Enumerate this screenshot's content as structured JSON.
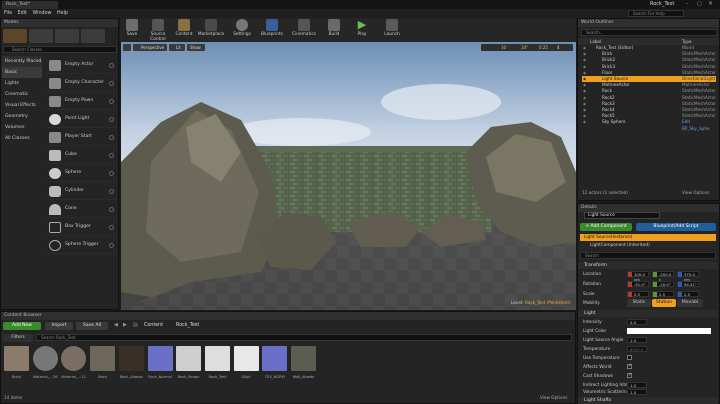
{
  "window": {
    "tab": "Rock_Test*",
    "project": "Rock_Test"
  },
  "menu": [
    "File",
    "Edit",
    "Window",
    "Help"
  ],
  "search_help": "Search For Help",
  "modes": {
    "title": "Modes",
    "search": "Search Classes",
    "categories": [
      "Recently Placed",
      "Basic",
      "Lights",
      "Cinematic",
      "Visual Effects",
      "Geometry",
      "Volumes",
      "All Classes"
    ],
    "items": [
      "Empty Actor",
      "Empty Character",
      "Empty Pawn",
      "Point Light",
      "Player Start",
      "Cube",
      "Sphere",
      "Cylinder",
      "Cone",
      "Box Trigger",
      "Sphere Trigger"
    ]
  },
  "toolbar": [
    "Save",
    "Source Control",
    "Content",
    "Marketplace",
    "Settings",
    "Blueprints",
    "Cinematics",
    "Build",
    "Play",
    "Launch"
  ],
  "viewport": {
    "perspective": "Perspective",
    "lit": "Lit",
    "show": "Show",
    "grid": "10",
    "angle": "10°",
    "scale": "0.25",
    "cam": "4",
    "level_label": "Level:",
    "level_name": "Rock_Test (Persistent)"
  },
  "outliner": {
    "title": "World Outliner",
    "search": "Search...",
    "col_label": "Label",
    "col_type": "Type",
    "rows": [
      [
        "Rock_Test (Editor)",
        "World"
      ],
      [
        "Brick",
        "StaticMeshActor"
      ],
      [
        "Brick2",
        "StaticMeshActor"
      ],
      [
        "Brick3",
        "StaticMeshActor"
      ],
      [
        "Floor",
        "StaticMeshActor"
      ],
      [
        "Light Source",
        "DirectionalLight"
      ],
      [
        "MatineeActor",
        "MatineeActor"
      ],
      [
        "Rock",
        "StaticMeshActor"
      ],
      [
        "Rock2",
        "StaticMeshActor"
      ],
      [
        "Rock3",
        "StaticMeshActor"
      ],
      [
        "Rock4",
        "StaticMeshActor"
      ],
      [
        "Rock5",
        "StaticMeshActor"
      ],
      [
        "Sky Sphere",
        "Edit BP_Sky_Sphe"
      ]
    ],
    "footer": "12 actors (1 selected)",
    "view_options": "View Options"
  },
  "details": {
    "title": "Details",
    "name": "Light Source",
    "add_component": "+ Add Component",
    "blueprint": "Blueprint/Add Script",
    "comp1": "Light Source(Instance)",
    "comp2": "LightComponent (Inherited)",
    "search": "Search",
    "transform": "Transform",
    "location": "Location",
    "rotation": "Rotation",
    "scale": "Scale",
    "loc": [
      "100.0 cm",
      "-200.0 c",
      "370.0 cm"
    ],
    "rot": [
      "-51.0°",
      "-20.0°",
      "94.41°"
    ],
    "scl": [
      "2.5",
      "2.5",
      "2.5"
    ],
    "mobility": "Mobility",
    "mob_opts": [
      "Static",
      "Station",
      "Movabl"
    ],
    "light": "Light",
    "intensity": "Intensity",
    "intensity_val": "5.0",
    "light_color": "Light Color",
    "source_angle": "Light Source Angle",
    "source_angle_val": "1.0",
    "temperature": "Temperature",
    "temperature_val": "6500.0",
    "use_temp": "Use Temperature",
    "affects_world": "Affects World",
    "cast_shadows": "Cast Shadows",
    "indirect": "Indirect Lighting Inten",
    "indirect_val": "1.0",
    "volumetric": "Volumetric Scattering I",
    "volumetric_val": "1.0",
    "light_shafts": "Light Shafts"
  },
  "content": {
    "title": "Content Browser",
    "add_new": "Add New",
    "import": "Import",
    "save_all": "Save All",
    "path": [
      "Content",
      "Rock_Test"
    ],
    "filters": "Filters",
    "search": "Search Rock_Test",
    "footer": "14 items",
    "view_options": "View Options",
    "assets": [
      "Brick",
      "Material_...26",
      "Material_...120",
      "Rock",
      "Rock_Albedo",
      "Rock_Normal",
      "Rock_Rough",
      "Rock_Test",
      "SSph",
      "TEX_NGRM",
      "Wall_Albedo"
    ]
  },
  "colors": {
    "accent": "#f0a020",
    "selected": "#3e6fa8",
    "add_green": "#3c8a2e",
    "bp_blue": "#1f5f9c",
    "x": "#b83a2a",
    "y": "#5a9a2a",
    "z": "#2a5ab8"
  }
}
